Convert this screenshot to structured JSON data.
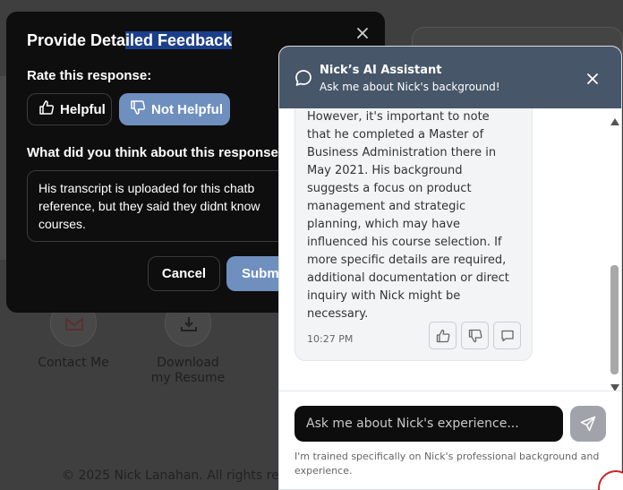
{
  "background": {
    "actions": [
      {
        "label_line1": "Contact Me",
        "label_line2": ""
      },
      {
        "label_line1": "Download",
        "label_line2": "my Resume"
      }
    ],
    "footer": "© 2025 Nick Lanahan. All rights res"
  },
  "dialog": {
    "title_plain": "Provide Deta",
    "title_highlighted": "iled Feedback",
    "rate_label": "Rate this response:",
    "helpful_label": "Helpful",
    "not_helpful_label": "Not Helpful",
    "question_label": "What did you think about this response?",
    "feedback_value_lines": [
      "His transcript is uploaded for this chatb",
      "reference, but they said they didnt know",
      "courses."
    ],
    "cancel_label": "Cancel",
    "submit_label": "Submit"
  },
  "chat": {
    "title": "Nick’s AI Assistant",
    "subtitle": "Ask me about Nick's background!",
    "message_lines": [
      "However, it's important to note",
      "that he completed a Master of",
      "Business Administration there in",
      "May 2021. His background",
      "suggests a focus on product",
      "management and strategic",
      "planning, which may have",
      "influenced his course selection. If",
      "more specific details are required,",
      "additional documentation or direct",
      "inquiry with Nick might be",
      "necessary."
    ],
    "message_time": "10:27 PM",
    "input_placeholder": "Ask me about Nick's experience...",
    "disclaimer": "I'm trained specifically on Nick's professional background and experience."
  }
}
